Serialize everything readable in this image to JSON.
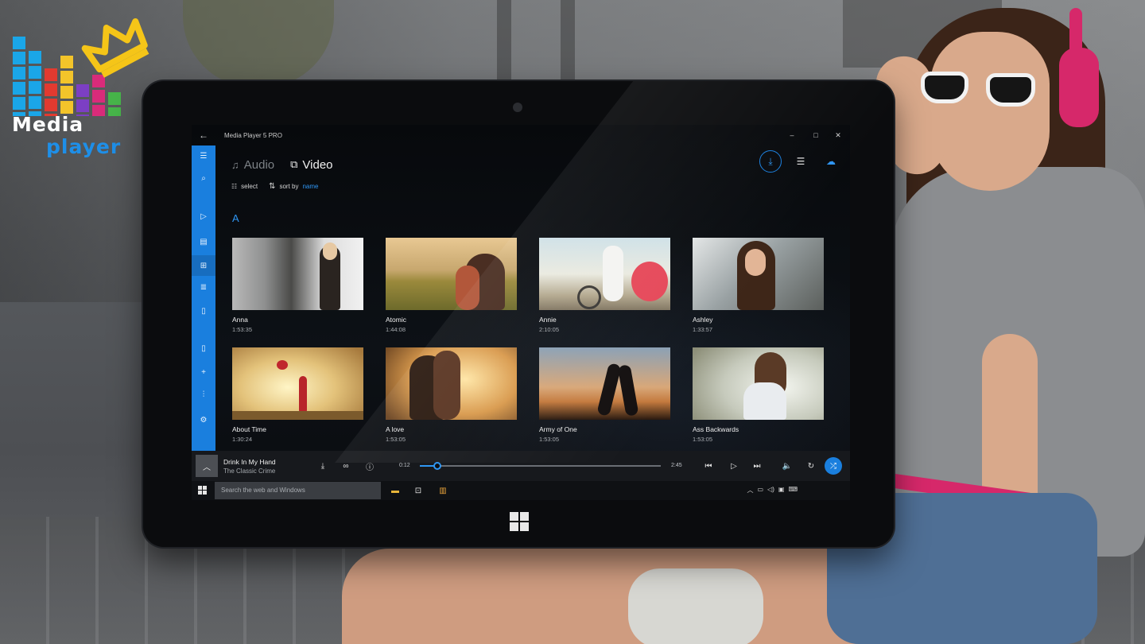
{
  "logo": {
    "line1": "Media",
    "line2": "player"
  },
  "app": {
    "title": "Media Player 5 PRO",
    "window_controls": {
      "minimize": "–",
      "maximize": "□",
      "close": "✕"
    }
  },
  "tabs": [
    {
      "label": "Audio",
      "active": false
    },
    {
      "label": "Video",
      "active": true
    }
  ],
  "toolbar": {
    "select_label": "select",
    "sort_label": "sort by",
    "sort_value": "name"
  },
  "section_letter": "A",
  "videos": [
    {
      "title": "Anna",
      "duration": "1:53:35"
    },
    {
      "title": "Atomic",
      "duration": "1:44:08"
    },
    {
      "title": "Annie",
      "duration": "2:10:05"
    },
    {
      "title": "Ashley",
      "duration": "1:33:57"
    },
    {
      "title": "About Time",
      "duration": "1:30:24"
    },
    {
      "title": "A love",
      "duration": "1:53:05"
    },
    {
      "title": "Army of One",
      "duration": "1:53:05"
    },
    {
      "title": "Ass Backwards",
      "duration": "1:53:05"
    }
  ],
  "player": {
    "song": "Drink In My Hand",
    "artist": "The Classic Crime",
    "elapsed": "0:12",
    "total": "2:45",
    "progress": 0.073
  },
  "taskbar": {
    "search_placeholder": "Search the web and Windows"
  },
  "colors": {
    "accent": "#1a7fde",
    "highlight": "#2f96f3",
    "background": "#0b0d10"
  },
  "icons": {
    "sidebar": [
      "menu-icon",
      "search-icon",
      "play-icon",
      "playlist-icon",
      "grid-icon",
      "list-icon",
      "device-icon",
      "phone-icon",
      "add-icon",
      "equalizer-icon",
      "settings-icon"
    ]
  }
}
